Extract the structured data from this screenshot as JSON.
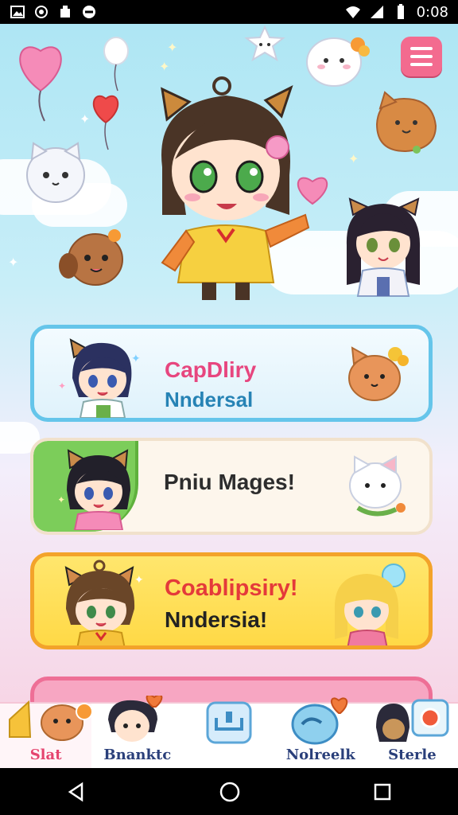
{
  "status_bar": {
    "time": "0:08"
  },
  "cards": [
    {
      "line1": "CapDliry",
      "line2": "Nndersal"
    },
    {
      "line1": "Pniu Mages!"
    },
    {
      "line1": "Coablipsiry!",
      "line2": "Nndersia!"
    },
    {}
  ],
  "bottom_nav": {
    "items": [
      {
        "label": "Slat",
        "icon": "home-icon"
      },
      {
        "label": "Bnanktc",
        "icon": "friends-icon"
      },
      {
        "label": "",
        "icon": "inbox-icon"
      },
      {
        "label": "Nolreelk",
        "icon": "chat-bubble-icon"
      },
      {
        "label": "Sterle",
        "icon": "camera-icon"
      }
    ]
  },
  "colors": {
    "accent_pink": "#f36b8f",
    "card_blue_border": "#65c5ea",
    "card_green_tab": "#7ccd5a",
    "card_yellow_border": "#f3a32a",
    "card_pink_border": "#ee6f96"
  }
}
